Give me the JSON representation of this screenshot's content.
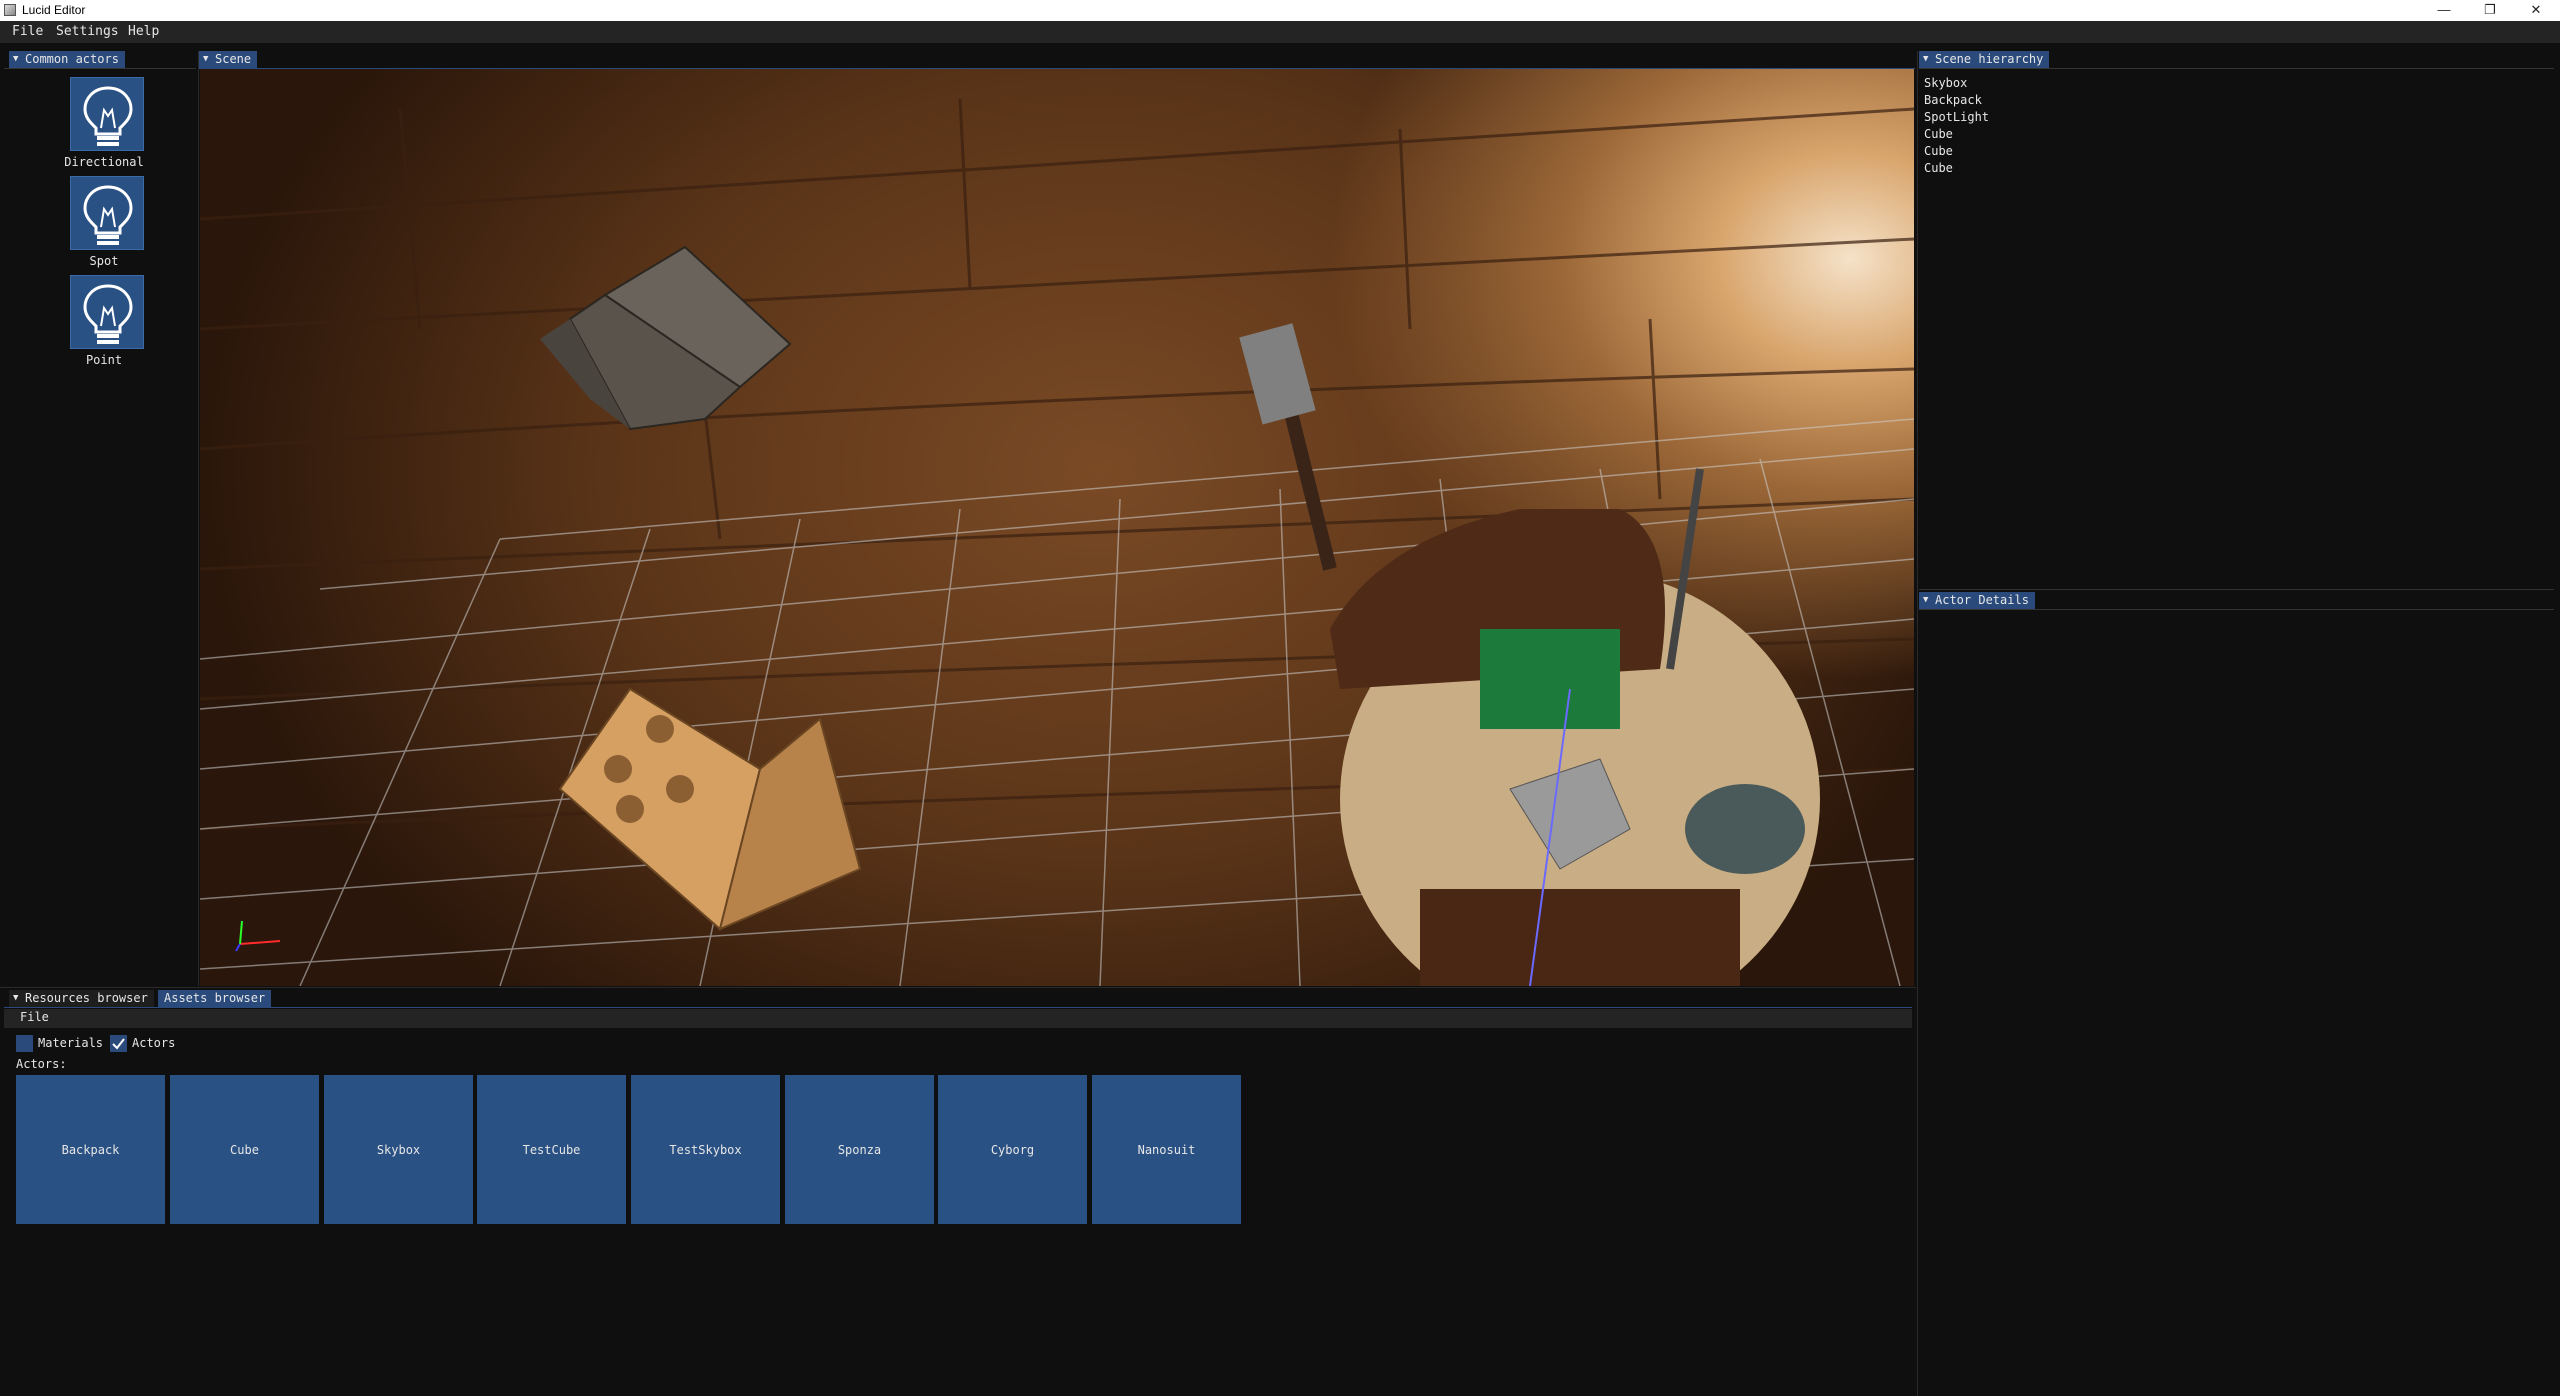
{
  "window": {
    "title": "Lucid Editor",
    "minimize_glyph": "—",
    "restore_glyph": "❐",
    "close_glyph": "✕"
  },
  "menu": {
    "items": [
      "File",
      "Settings",
      "Help"
    ]
  },
  "left_panel": {
    "tab": "Common actors",
    "actors": [
      {
        "label": "Directional",
        "icon": "light-bulb-icon"
      },
      {
        "label": "Spot",
        "icon": "light-bulb-icon"
      },
      {
        "label": "Point",
        "icon": "light-bulb-icon"
      }
    ]
  },
  "scene": {
    "tab": "Scene"
  },
  "hierarchy": {
    "tab": "Scene hierarchy",
    "items": [
      "Skybox",
      "Backpack",
      "SpotLight",
      "Cube",
      "Cube",
      "Cube"
    ]
  },
  "details": {
    "tab": "Actor Details"
  },
  "bottom": {
    "tabs": [
      "Resources browser",
      "Assets browser"
    ],
    "active_tab": "Assets browser",
    "menu_file": "File",
    "filters": [
      {
        "label": "Materials",
        "checked": false
      },
      {
        "label": "Actors",
        "checked": true
      }
    ],
    "section_label": "Actors:",
    "assets": [
      "Backpack",
      "Cube",
      "Skybox",
      "TestCube",
      "TestSkybox",
      "Sponza",
      "Cyborg",
      "Nanosuit"
    ]
  },
  "colors": {
    "panel_bg": "#0f0f0f",
    "accent": "#294a7a",
    "tile": "#2a5184",
    "text": "#e6e6e6"
  }
}
